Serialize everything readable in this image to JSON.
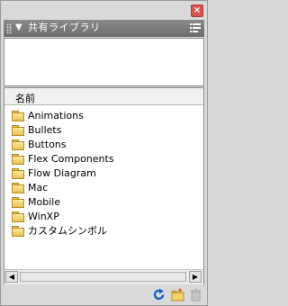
{
  "panel": {
    "title": "共有ライブラリ",
    "close_glyph": "×",
    "collapse_glyph": "▼",
    "column_header": "名前",
    "items": [
      "Animations",
      "Bullets",
      "Buttons",
      "Flex Components",
      "Flow Diagram",
      "Mac",
      "Mobile",
      "WinXP",
      "カスタムシンボル"
    ],
    "scroll_left_glyph": "◀",
    "scroll_right_glyph": "▶"
  },
  "colors": {
    "titlebar": "#7b7b7b",
    "close": "#d9534f",
    "folder": "#f2d36b"
  },
  "icons": [
    "close-icon",
    "grip-icon",
    "collapse-triangle-icon",
    "panel-menu-icon",
    "folder-icon",
    "refresh-icon",
    "new-folder-icon",
    "trash-icon"
  ]
}
